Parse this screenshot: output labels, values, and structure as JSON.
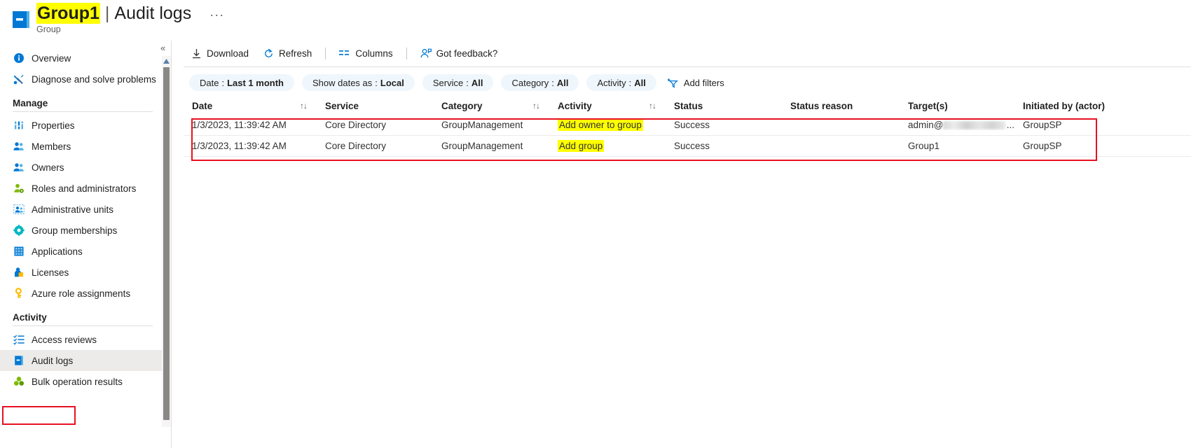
{
  "header": {
    "resource_name": "Group1",
    "separator": "|",
    "page_title": "Audit logs",
    "ellipsis": "···",
    "subtitle": "Group",
    "icon": "group-book-icon"
  },
  "sidebar": {
    "collapse_icon": "«",
    "scroll_up_icon": "scroll-up-arrow",
    "items": [
      {
        "label": "Overview",
        "icon": "info-circle-icon",
        "selected": false
      },
      {
        "label": "Diagnose and solve problems",
        "icon": "wrench-screwdriver-icon",
        "selected": false
      }
    ],
    "groups": [
      {
        "title": "Manage",
        "items": [
          {
            "label": "Properties",
            "icon": "properties-bars-icon",
            "selected": false
          },
          {
            "label": "Members",
            "icon": "members-people-icon",
            "selected": false
          },
          {
            "label": "Owners",
            "icon": "owners-people-icon",
            "selected": false
          },
          {
            "label": "Roles and administrators",
            "icon": "roles-person-gear-icon",
            "selected": false
          },
          {
            "label": "Administrative units",
            "icon": "administrative-units-icon",
            "selected": false
          },
          {
            "label": "Group memberships",
            "icon": "group-memberships-gear-icon",
            "selected": false
          },
          {
            "label": "Applications",
            "icon": "applications-grid-icon",
            "selected": false
          },
          {
            "label": "Licenses",
            "icon": "licenses-person-icon",
            "selected": false
          },
          {
            "label": "Azure role assignments",
            "icon": "key-icon",
            "selected": false
          }
        ]
      },
      {
        "title": "Activity",
        "items": [
          {
            "label": "Access reviews",
            "icon": "access-reviews-checklist-icon",
            "selected": false
          },
          {
            "label": "Audit logs",
            "icon": "audit-logs-book-icon",
            "selected": true
          },
          {
            "label": "Bulk operation results",
            "icon": "bulk-operation-clover-icon",
            "selected": false
          }
        ]
      }
    ]
  },
  "toolbar": {
    "download_label": "Download",
    "download_icon": "download-arrow-icon",
    "refresh_label": "Refresh",
    "refresh_icon": "refresh-circular-arrow-icon",
    "columns_label": "Columns",
    "columns_icon": "columns-icon",
    "feedback_label": "Got feedback?",
    "feedback_icon": "feedback-person-icon"
  },
  "filters": {
    "pills": [
      {
        "label": "Date",
        "value": "Last 1 month"
      },
      {
        "label": "Show dates as",
        "value": "Local"
      },
      {
        "label": "Service",
        "value": "All"
      },
      {
        "label": "Category",
        "value": "All"
      },
      {
        "label": "Activity",
        "value": "All"
      }
    ],
    "add_filters_label": "Add filters",
    "add_filters_icon": "add-filter-funnel-icon",
    "separator": ":"
  },
  "table": {
    "columns": [
      {
        "key": "date",
        "label": "Date",
        "sortable": true
      },
      {
        "key": "service",
        "label": "Service",
        "sortable": false
      },
      {
        "key": "category",
        "label": "Category",
        "sortable": true
      },
      {
        "key": "activity",
        "label": "Activity",
        "sortable": true
      },
      {
        "key": "status",
        "label": "Status",
        "sortable": false
      },
      {
        "key": "reason",
        "label": "Status reason",
        "sortable": false
      },
      {
        "key": "target",
        "label": "Target(s)",
        "sortable": false
      },
      {
        "key": "actor",
        "label": "Initiated by (actor)",
        "sortable": false
      }
    ],
    "sort_icon": "↑↓",
    "rows": [
      {
        "date": "1/3/2023, 11:39:42 AM",
        "service": "Core Directory",
        "category": "GroupManagement",
        "activity": "Add owner to group",
        "activity_highlighted": true,
        "status": "Success",
        "reason": "",
        "target_prefix": "admin@",
        "target_redacted": true,
        "target_suffix": "...",
        "target": "",
        "actor": "GroupSP"
      },
      {
        "date": "1/3/2023, 11:39:42 AM",
        "service": "Core Directory",
        "category": "GroupManagement",
        "activity": "Add group",
        "activity_highlighted": true,
        "status": "Success",
        "reason": "",
        "target_prefix": "",
        "target_redacted": false,
        "target_suffix": "",
        "target": "Group1",
        "actor": "GroupSP"
      }
    ]
  },
  "annotations": {
    "highlight_color": "#ffff00",
    "box_color": "#e81123",
    "boxes": [
      {
        "name": "audit-logs-nav-annotation"
      },
      {
        "name": "results-rows-annotation"
      }
    ]
  }
}
